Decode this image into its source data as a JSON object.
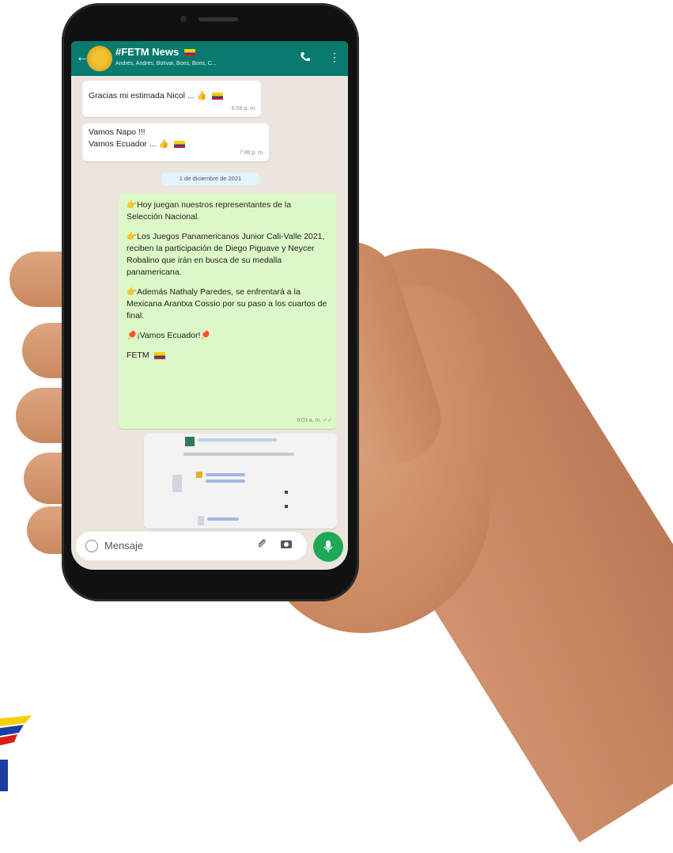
{
  "header": {
    "back_glyph": "←",
    "title": "#FETM News",
    "subtitle": "Andrés, Andrés, Bolívar, Boris, Boris, C...",
    "call_icon": "phone-call-icon",
    "menu_glyph": "⋮"
  },
  "messages": [
    {
      "text": "Gracias mi estimada Nicol ... 👍",
      "time": "6:59 p. m."
    },
    {
      "line1": "Vamos Napo !!!",
      "line2": "Vamos Ecuador ... 👍",
      "time": "7:00 p. m."
    }
  ],
  "date_chip": "1 de diciembre de 2021",
  "long_message": {
    "p1": "👉Hoy juegan nuestros representantes de la Selección Nacional.",
    "p2": "👉Los Juegos Panamericanos Junior Cali-Valle 2021, reciben la participación de Diego Piguave y Neycer Robalino que irán en busca de su medalla panamericana.",
    "p3": "👉Además Nathaly Paredes, se enfrentará a la Mexicana Arantxa Cossio por su paso a los cuartos de final.",
    "p4": "🏓¡Vamos Ecuador!🏓",
    "signature": "FETM",
    "time": "9:03 a. m. ✓✓"
  },
  "input": {
    "placeholder": "Mensaje"
  },
  "colors": {
    "header": "#0b7a6e",
    "sent_bubble": "#dcf8c6",
    "mic": "#1fa855"
  }
}
